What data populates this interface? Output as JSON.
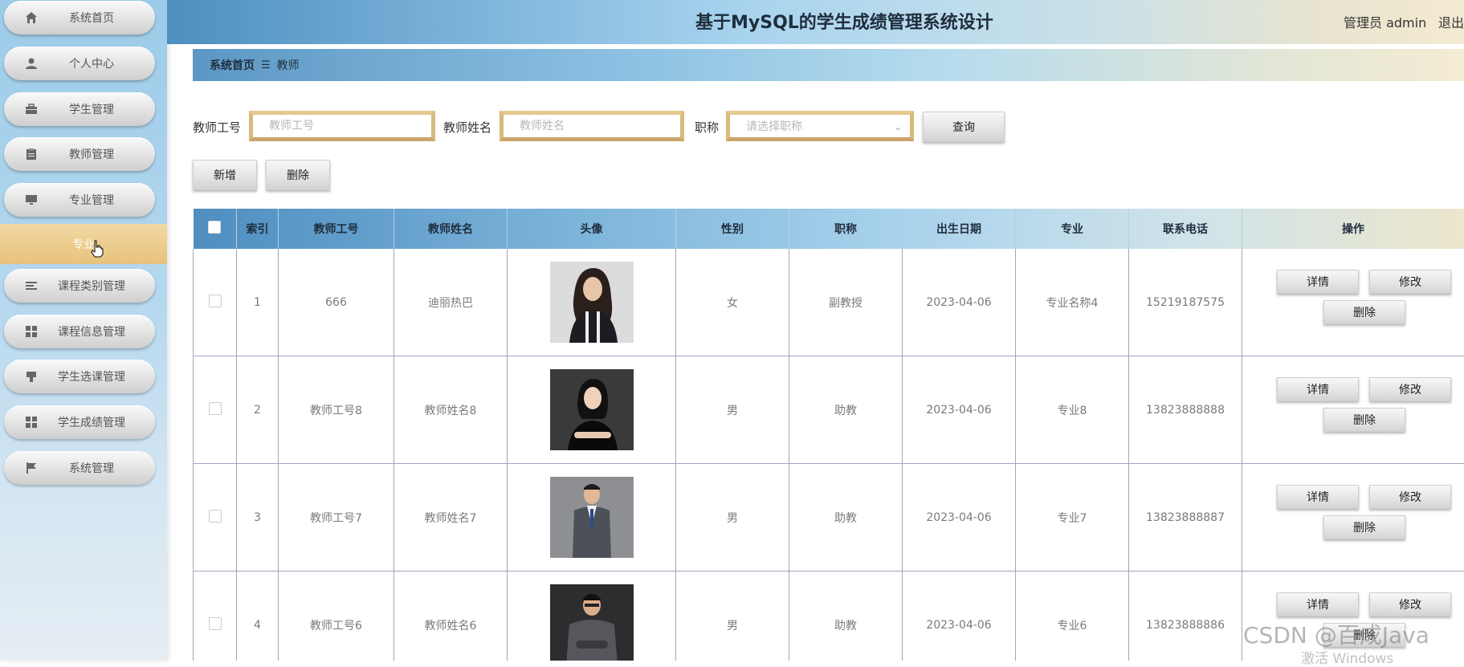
{
  "header": {
    "title": "基于MySQL的学生成绩管理系统设计",
    "user": "管理员 admin",
    "logout": "退出"
  },
  "sidebar": {
    "items": [
      {
        "label": "系统首页",
        "icon": "home-icon"
      },
      {
        "label": "个人中心",
        "icon": "user-icon"
      },
      {
        "label": "学生管理",
        "icon": "briefcase-icon"
      },
      {
        "label": "教师管理",
        "icon": "clipboard-icon"
      },
      {
        "label": "专业管理",
        "icon": "monitor-icon"
      },
      {
        "label": "课程类别管理",
        "icon": "list-icon"
      },
      {
        "label": "课程信息管理",
        "icon": "grid-icon"
      },
      {
        "label": "学生选课管理",
        "icon": "pin-icon"
      },
      {
        "label": "学生成绩管理",
        "icon": "grid-icon"
      },
      {
        "label": "系统管理",
        "icon": "flag-icon"
      }
    ],
    "active_sub": "专业"
  },
  "breadcrumb": {
    "home": "系统首页",
    "sep": "☰",
    "current": "教师"
  },
  "search": {
    "teacher_no_label": "教师工号",
    "teacher_no_placeholder": "教师工号",
    "teacher_name_label": "教师姓名",
    "teacher_name_placeholder": "教师姓名",
    "title_label": "职称",
    "title_placeholder": "请选择职称",
    "query_label": "查询",
    "add_label": "新增",
    "delete_label": "删除"
  },
  "table": {
    "headers": [
      "索引",
      "教师工号",
      "教师姓名",
      "头像",
      "性别",
      "职称",
      "出生日期",
      "专业",
      "联系电话",
      "操作"
    ],
    "rows": [
      {
        "index": "1",
        "no": "666",
        "name": "迪丽热巴",
        "gender": "女",
        "title": "副教授",
        "birth": "2023-04-06",
        "major": "专业名称4",
        "phone": "15219187575"
      },
      {
        "index": "2",
        "no": "教师工号8",
        "name": "教师姓名8",
        "gender": "男",
        "title": "助教",
        "birth": "2023-04-06",
        "major": "专业8",
        "phone": "13823888888"
      },
      {
        "index": "3",
        "no": "教师工号7",
        "name": "教师姓名7",
        "gender": "男",
        "title": "助教",
        "birth": "2023-04-06",
        "major": "专业7",
        "phone": "13823888887"
      },
      {
        "index": "4",
        "no": "教师工号6",
        "name": "教师姓名6",
        "gender": "男",
        "title": "助教",
        "birth": "2023-04-06",
        "major": "专业6",
        "phone": "13823888886"
      }
    ],
    "op_detail": "详情",
    "op_edit": "修改",
    "op_delete": "删除"
  },
  "watermark": {
    "csdn": "CSDN @百成Java",
    "activate": "激活 Windows"
  },
  "colors": {
    "accent_gold": "#d9b97b",
    "header_blue": "#4e8fbf",
    "sub_active": "#e7c27c"
  }
}
